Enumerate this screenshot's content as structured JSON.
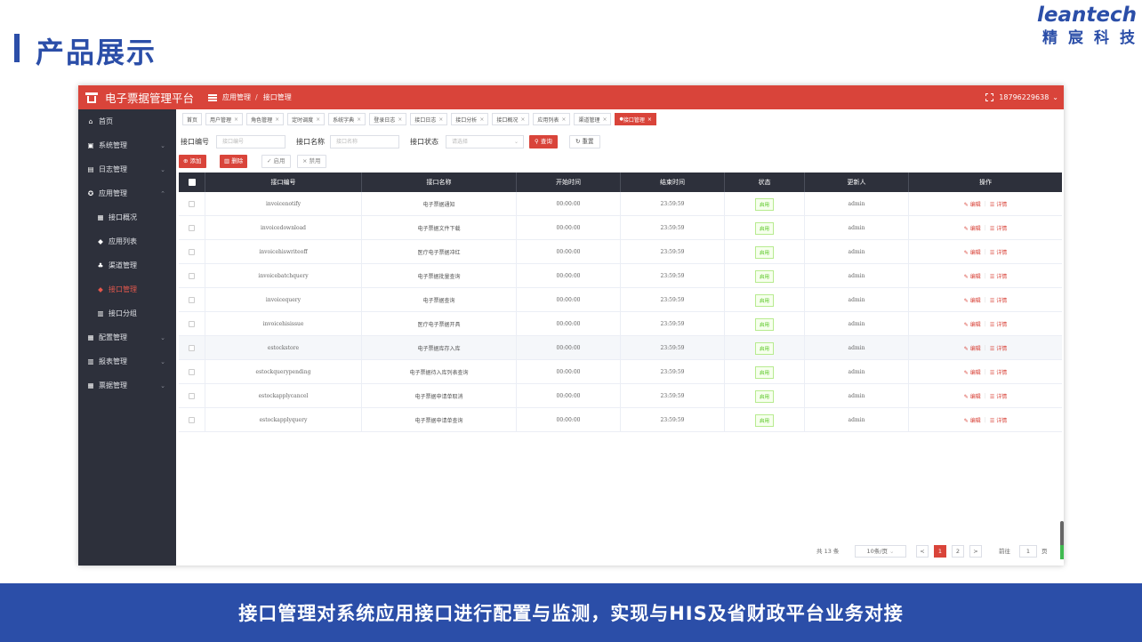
{
  "slide": {
    "title": "产品展示",
    "brand_en": "leantech",
    "brand_cn": "精宸科技",
    "footer": "接口管理对系统应用接口进行配置与监测，实现与HIS及省财政平台业务对接"
  },
  "app": {
    "title": "电子票据管理平台",
    "breadcrumb": [
      "应用管理",
      "接口管理"
    ],
    "breadcrumb_sep": "/",
    "user": "18796229638",
    "colors": {
      "primary": "#d9443a",
      "sidebar": "#2d303b",
      "slide_blue": "#2b4ea8"
    }
  },
  "sidebar": {
    "items": [
      {
        "label": "首页",
        "icon": "home-icon",
        "glyph": "⌂",
        "has_arrow": false
      },
      {
        "label": "系统管理",
        "icon": "lock-icon",
        "glyph": "▣",
        "has_arrow": true
      },
      {
        "label": "日志管理",
        "icon": "log-icon",
        "glyph": "▤",
        "has_arrow": true
      },
      {
        "label": "应用管理",
        "icon": "app-icon",
        "glyph": "✪",
        "has_arrow": true,
        "expanded": true
      },
      {
        "label": "接口概况",
        "icon": "grid-icon",
        "glyph": "▦",
        "sub": true
      },
      {
        "label": "应用列表",
        "icon": "list-icon",
        "glyph": "◆",
        "sub": true
      },
      {
        "label": "渠道管理",
        "icon": "share-icon",
        "glyph": "♣",
        "sub": true
      },
      {
        "label": "接口管理",
        "icon": "plug-icon",
        "glyph": "◆",
        "sub": true,
        "active": true
      },
      {
        "label": "接口分组",
        "icon": "group-icon",
        "glyph": "▥",
        "sub": true
      },
      {
        "label": "配置管理",
        "icon": "config-icon",
        "glyph": "▦",
        "has_arrow": true
      },
      {
        "label": "报表管理",
        "icon": "chart-icon",
        "glyph": "▥",
        "has_arrow": true
      },
      {
        "label": "票据管理",
        "icon": "ticket-icon",
        "glyph": "▦",
        "has_arrow": true
      }
    ]
  },
  "tabs": [
    {
      "label": "首页",
      "closable": false
    },
    {
      "label": "用户管理",
      "closable": true
    },
    {
      "label": "角色管理",
      "closable": true
    },
    {
      "label": "定时调度",
      "closable": true
    },
    {
      "label": "系统字典",
      "closable": true
    },
    {
      "label": "登录日志",
      "closable": true
    },
    {
      "label": "接口日志",
      "closable": true
    },
    {
      "label": "接口分析",
      "closable": true
    },
    {
      "label": "接口概况",
      "closable": true
    },
    {
      "label": "应用列表",
      "closable": true
    },
    {
      "label": "渠道管理",
      "closable": true
    },
    {
      "label": "接口管理",
      "closable": true,
      "active": true
    }
  ],
  "search": {
    "code_label": "接口编号",
    "code_placeholder": "接口编号",
    "name_label": "接口名称",
    "name_placeholder": "接口名称",
    "status_label": "接口状态",
    "status_placeholder": "请选择",
    "search_btn": "查询",
    "reset_btn": "重置"
  },
  "toolbar": {
    "add": "添加",
    "delete": "删除",
    "enable": "启用",
    "disable": "禁用"
  },
  "table": {
    "headers": [
      "接口编号",
      "接口名称",
      "开始时间",
      "结束时间",
      "状态",
      "更新人",
      "操作"
    ],
    "edit_label": "编辑",
    "detail_label": "详情",
    "rows": [
      {
        "code": "invoicenotify",
        "name": "电子票据通知",
        "start": "00:00:00",
        "end": "23:59:59",
        "status": "启用",
        "updater": "admin"
      },
      {
        "code": "invoicedownload",
        "name": "电子票据文件下载",
        "start": "00:00:00",
        "end": "23:59:59",
        "status": "启用",
        "updater": "admin"
      },
      {
        "code": "invoicehiswriteoff",
        "name": "医疗电子票据冲红",
        "start": "00:00:00",
        "end": "23:59:59",
        "status": "启用",
        "updater": "admin"
      },
      {
        "code": "invoicebatchquery",
        "name": "电子票据批量查询",
        "start": "00:00:00",
        "end": "23:59:59",
        "status": "启用",
        "updater": "admin"
      },
      {
        "code": "invoicequery",
        "name": "电子票据查询",
        "start": "00:00:00",
        "end": "23:59:59",
        "status": "启用",
        "updater": "admin"
      },
      {
        "code": "invoicehisissue",
        "name": "医疗电子票据开具",
        "start": "00:00:00",
        "end": "23:59:59",
        "status": "启用",
        "updater": "admin"
      },
      {
        "code": "estockstore",
        "name": "电子票据库存入库",
        "start": "00:00:00",
        "end": "23:59:59",
        "status": "启用",
        "updater": "admin",
        "highlight": true
      },
      {
        "code": "estockquerypending",
        "name": "电子票据待入库列表查询",
        "start": "00:00:00",
        "end": "23:59:59",
        "status": "启用",
        "updater": "admin"
      },
      {
        "code": "estockapplycancel",
        "name": "电子票据申请单取消",
        "start": "00:00:00",
        "end": "23:59:59",
        "status": "启用",
        "updater": "admin"
      },
      {
        "code": "estockapplyquery",
        "name": "电子票据申请单查询",
        "start": "00:00:00",
        "end": "23:59:59",
        "status": "启用",
        "updater": "admin"
      }
    ]
  },
  "pagination": {
    "total": "共 13 条",
    "page_size": "10条/页",
    "prev": "<",
    "pages": [
      "1",
      "2"
    ],
    "current": "1",
    "next": ">",
    "goto_label": "前往",
    "goto_value": "1",
    "page_suffix": "页"
  }
}
